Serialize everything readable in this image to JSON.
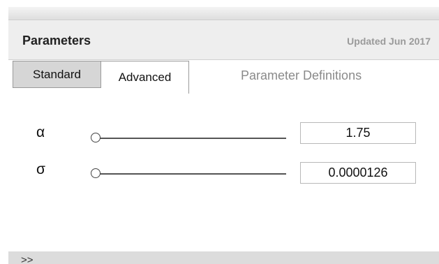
{
  "header": {
    "title": "Parameters",
    "updated": "Updated Jun 2017"
  },
  "tabs": [
    {
      "label": "Standard",
      "active": false
    },
    {
      "label": "Advanced",
      "active": true
    }
  ],
  "definitions_link": "Parameter Definitions",
  "parameters": [
    {
      "symbol": "α",
      "value": "1.75",
      "slider_position": 0
    },
    {
      "symbol": "σ",
      "value": "0.0000126",
      "slider_position": 0
    }
  ],
  "footer": {
    "toggle_label": ">>"
  }
}
